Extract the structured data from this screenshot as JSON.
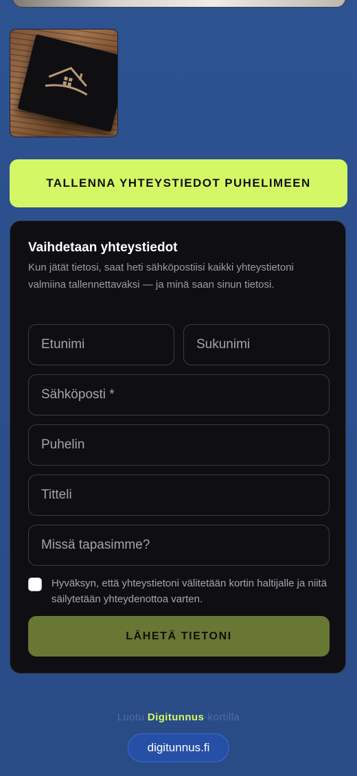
{
  "save_contact_button": "TALLENNA YHTEYSTIEDOT PUHELIMEEN",
  "exchange": {
    "title": "Vaihdetaan yhteystiedot",
    "description": "Kun jätät tietosi, saat heti sähköpostiisi kaikki yhteystietoni valmiina tallennettavaksi — ja minä saan sinun tietosi.",
    "fields": {
      "first_name": "Etunimi",
      "last_name": "Sukunimi",
      "email": "Sähköposti *",
      "phone": "Puhelin",
      "title": "Titteli",
      "where_met": "Missä tapasimme?"
    },
    "consent_text": "Hyväksyn, että yhteystietoni välitetään kortin haltijalle ja niitä säilytetään yhteydenottoa varten.",
    "submit_label": "LÄHETÄ TIETONI"
  },
  "footer": {
    "prefix": "Luotu",
    "brand": "Digitunnus",
    "suffix": "-kortilla",
    "link_label": "digitunnus.fi"
  },
  "colors": {
    "background": "#2b4f8c",
    "accent": "#d4f865",
    "panel": "#0f0f13",
    "submit": "#687834"
  },
  "icons": {
    "logo": "house-logo-icon"
  }
}
